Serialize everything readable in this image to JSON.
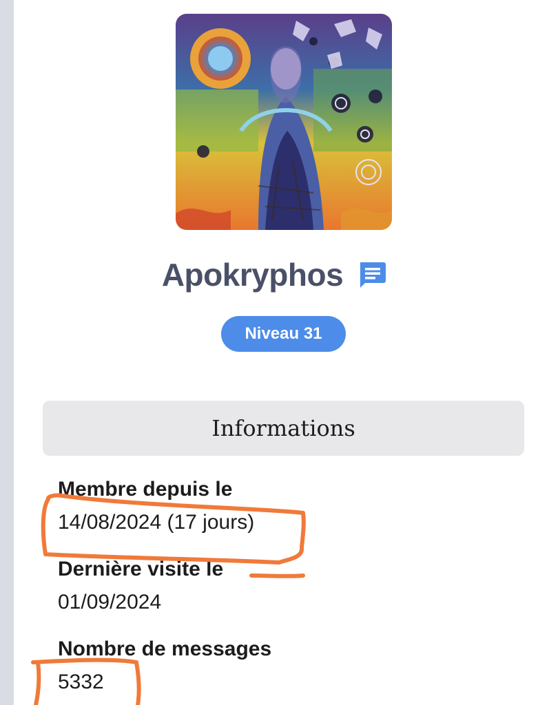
{
  "profile": {
    "username": "Apokryphos",
    "level_badge": "Niveau 31"
  },
  "icons": {
    "message": "chat-bubble-icon",
    "avatar": "tarot-art-avatar"
  },
  "colors": {
    "username": "#4a5067",
    "badge_bg": "#4d8ce8",
    "message_icon": "#4d8ce8",
    "section_header_bg": "#e8e8ea",
    "annotation": "#f07a3a"
  },
  "info": {
    "section_title": "Informations",
    "member_since_label": "Membre depuis le",
    "member_since_value": "14/08/2024 (17 jours)",
    "last_visit_label": "Dernière visite le",
    "last_visit_value": "01/09/2024",
    "messages_label": "Nombre de messages",
    "messages_value": "5332"
  }
}
